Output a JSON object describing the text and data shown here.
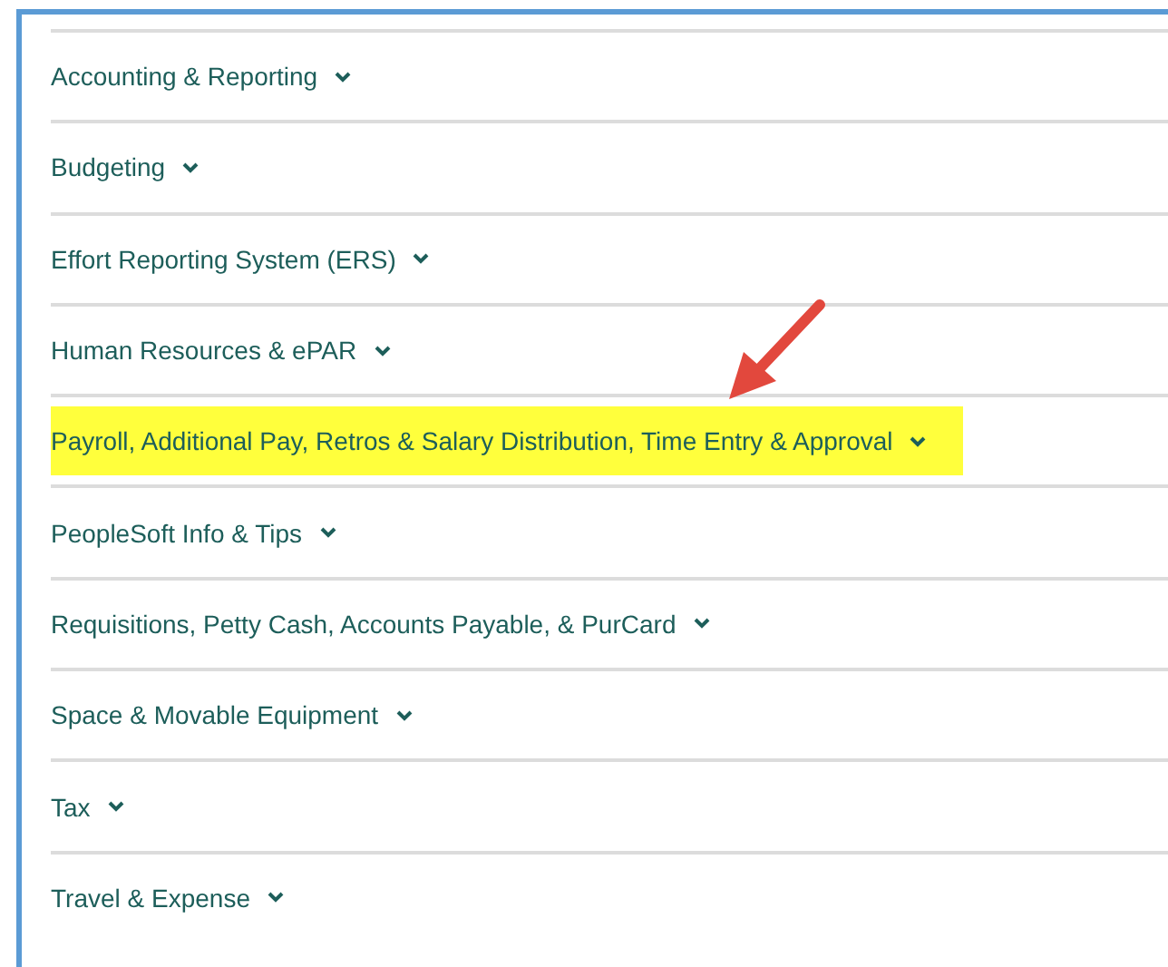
{
  "menu": [
    {
      "label": "Accounting & Reporting",
      "highlighted": false
    },
    {
      "label": "Budgeting",
      "highlighted": false
    },
    {
      "label": "Effort Reporting System (ERS)",
      "highlighted": false
    },
    {
      "label": "Human Resources & ePAR",
      "highlighted": false
    },
    {
      "label": "Payroll, Additional Pay, Retros & Salary Distribution, Time Entry & Approval",
      "highlighted": true
    },
    {
      "label": "PeopleSoft Info & Tips",
      "highlighted": false
    },
    {
      "label": "Requisitions, Petty Cash, Accounts Payable, & PurCard",
      "highlighted": false
    },
    {
      "label": "Space & Movable Equipment",
      "highlighted": false
    },
    {
      "label": "Tax",
      "highlighted": false
    },
    {
      "label": "Travel & Expense",
      "highlighted": false
    }
  ]
}
